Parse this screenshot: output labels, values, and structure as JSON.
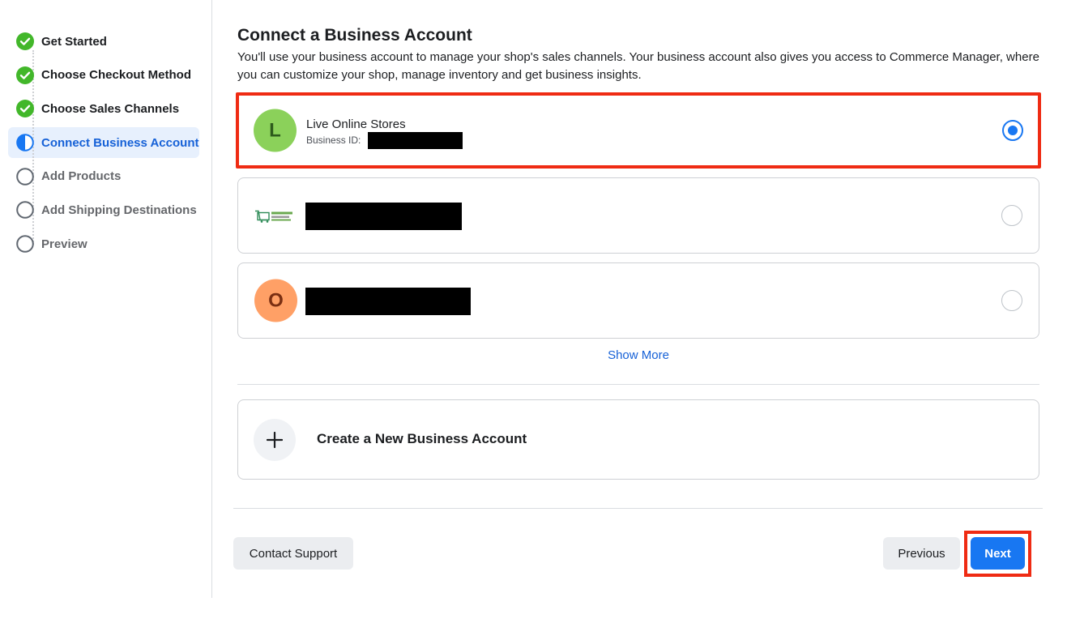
{
  "sidebar": {
    "steps": [
      {
        "label": "Get Started",
        "state": "done"
      },
      {
        "label": "Choose Checkout Method",
        "state": "done"
      },
      {
        "label": "Choose Sales Channels",
        "state": "done"
      },
      {
        "label": "Connect Business Account",
        "state": "active"
      },
      {
        "label": "Add Products",
        "state": "todo"
      },
      {
        "label": "Add Shipping Destinations",
        "state": "todo"
      },
      {
        "label": "Preview",
        "state": "todo"
      }
    ]
  },
  "main": {
    "title": "Connect a Business Account",
    "description": "You'll use your business account to manage your shop's sales channels. Your business account also gives you access to Commerce Manager, where you can customize your shop, manage inventory and get business insights.",
    "accounts": [
      {
        "initial": "L",
        "name": "Live Online Stores",
        "id_label": "Business ID:",
        "selected": true
      },
      {
        "initial": "",
        "name": "",
        "selected": false
      },
      {
        "initial": "O",
        "name": "",
        "selected": false
      }
    ],
    "show_more": "Show More",
    "create_label": "Create a New Business Account"
  },
  "footer": {
    "contact_support": "Contact Support",
    "previous": "Previous",
    "next": "Next"
  },
  "colors": {
    "accent": "#1877f2",
    "check_green": "#42b72a",
    "highlight_red": "#ef2b13",
    "avatar_green": "#8bd15a",
    "avatar_orange": "#ffa066"
  }
}
